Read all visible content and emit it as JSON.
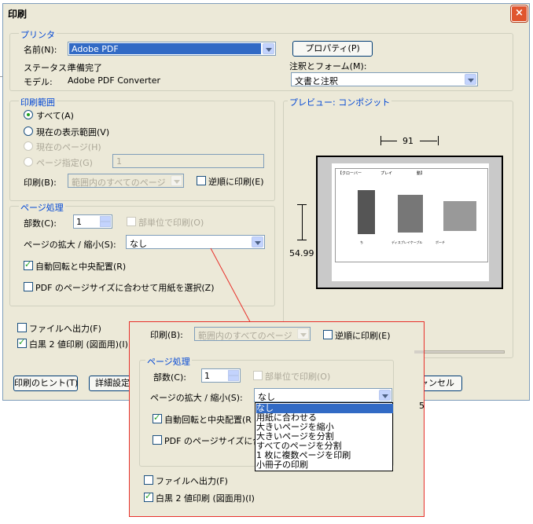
{
  "dialog": {
    "title": "印刷",
    "close_glyph": "×"
  },
  "printer": {
    "legend": "プリンタ",
    "name_label": "名前(N):",
    "name_value": "Adobe PDF",
    "properties_label": "プロパティ(P)",
    "status_label": "ステータス:",
    "status_value": "準備完了",
    "model_label": "モデル:",
    "model_value": "Adobe PDF Converter",
    "comments_label": "注釈とフォーム(M):",
    "comments_value": "文書と注釈"
  },
  "range": {
    "legend": "印刷範囲",
    "all": "すべて(A)",
    "current_view": "現在の表示範囲(V)",
    "current_page": "現在のページ(H)",
    "pages": "ページ指定(G)",
    "pages_value": "1",
    "print_label": "印刷(B):",
    "print_value": "範囲内のすべてのページ",
    "reverse": "逆順に印刷(E)"
  },
  "page_handling": {
    "legend": "ページ処理",
    "copies_label": "部数(C):",
    "copies_value": "1",
    "collate": "部単位で印刷(O)",
    "scaling_label": "ページの拡大 / 縮小(S):",
    "scaling_value": "なし",
    "auto_rotate": "自動回転と中央配置(R)",
    "choose_paper": "PDF のページサイズに合わせて用紙を選択(Z)"
  },
  "options": {
    "print_to_file": "ファイルへ出力(F)",
    "mono": "白黒 2 値印刷 (図面用)(I)"
  },
  "preview": {
    "legend": "プレビュー: コンポジット",
    "width_value": "91",
    "height_value": "54.99",
    "labels": [
      "【クローバー",
      "プレイ",
      "動】"
    ],
    "captions": [
      "ち",
      "ディスプレイケーブル",
      "ポーチ"
    ]
  },
  "footer": {
    "hint": "印刷のヒント(T)",
    "details": "詳細設定",
    "cancel": "キャンセル"
  },
  "zoom": {
    "print_label": "印刷(B):",
    "print_value": "範囲内のすべてのページ",
    "reverse": "逆順に印刷(E)",
    "legend": "ページ処理",
    "copies_label": "部数(C):",
    "copies_value": "1",
    "collate": "部単位で印刷(O)",
    "scaling_label": "ページの拡大 / 縮小(S):",
    "scaling_value": "なし",
    "auto_rotate": "自動回転と中央配置(R",
    "choose_paper": "PDF のページサイズに合",
    "print_to_file": "ファイルへ出力(F)",
    "mono": "白黒 2 値印刷 (図面用)(I)",
    "dropdown_items": [
      "なし",
      "用紙に合わせる",
      "大きいページを縮小",
      "大きいページを分割",
      "すべてのページを分割",
      "1 枚に複数ページを印刷",
      "小冊子の印刷"
    ],
    "edge_digit": "5"
  },
  "colors": {
    "accent_border": "#e8302a",
    "legend_blue": "#0046d5",
    "selection": "#316ac5"
  }
}
